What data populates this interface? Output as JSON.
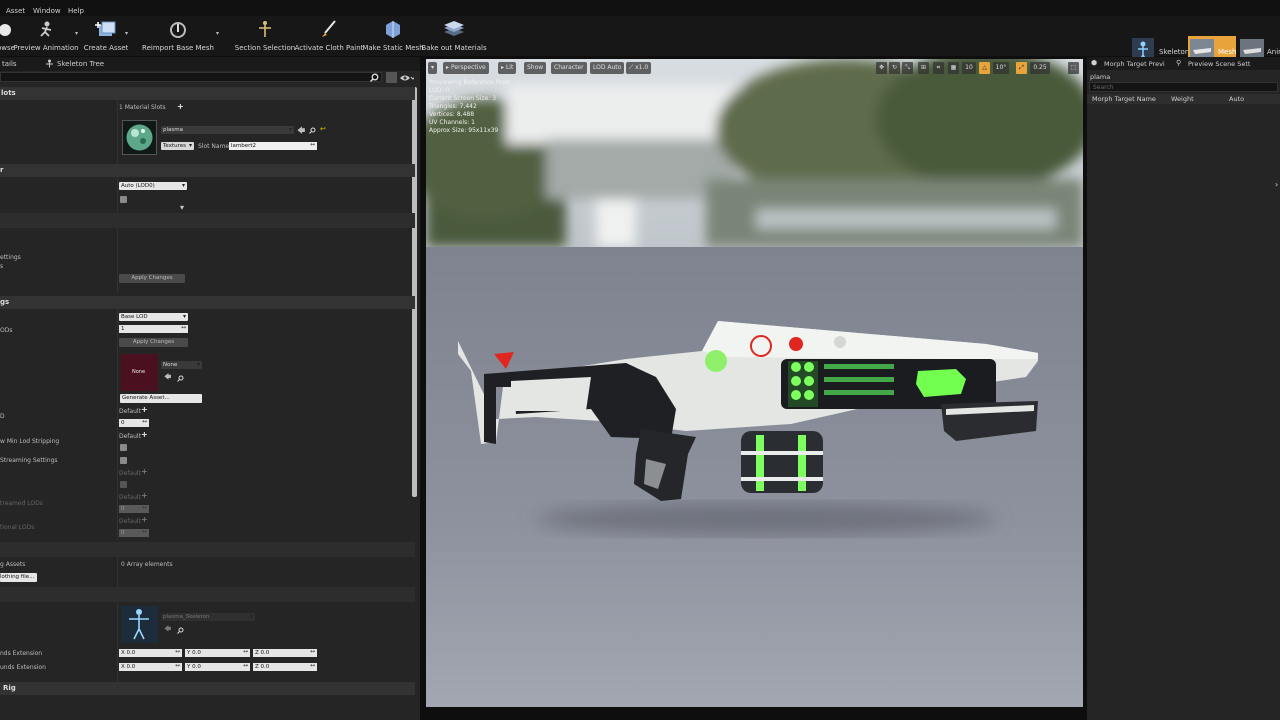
{
  "menu": {
    "asset": "Asset",
    "window": "Window",
    "help": "Help"
  },
  "toolbar": {
    "browse": "owse",
    "preview_animation": "Preview Animation",
    "create_asset": "Create Asset",
    "reimport": "Reimport Base Mesh",
    "section_selection": "Section Selection",
    "activate_cloth": "Activate Cloth Paint",
    "make_static": "Make Static Mesh",
    "bake_materials": "Bake out Materials"
  },
  "mode_tabs": {
    "skeleton": "Skeleton",
    "mesh": "Mesh",
    "animation": "Anim"
  },
  "left_panel": {
    "tab_details": "tails",
    "tab_skeleton_tree": "Skeleton Tree",
    "cat_material_slots": "lots",
    "material_slots_count": "1 Material Slots",
    "material_name": "plasma",
    "textures_label": "Textures",
    "slot_name_label": "Slot Name",
    "slot_name_value": "lambert2",
    "cat_lod": "r",
    "lod_auto": "Auto (LOD0)",
    "settings_label": "ettings",
    "settings_label2": "s",
    "apply_changes": "Apply Changes",
    "cat_lod_settings": "gs",
    "lods_label": "ODs",
    "base_lod": "Base LOD",
    "lod_count": "1",
    "apply_changes2": "Apply Changes",
    "none_thumb": "None",
    "none_dropdown": "None",
    "generate_asset": "Generate Asset...",
    "default1": "Default",
    "val1": "0",
    "d_label": "D",
    "min_lod_label": "w Min Lod Stripping",
    "default2": "Default",
    "streaming_label": "Streaming Settings",
    "default3": "Default",
    "streamed_lods_label": "treamed LODs",
    "default4": "Default",
    "val2": "0",
    "optional_lods_label": "tional LODs",
    "default5": "Default",
    "val3": "0",
    "assets_label": "g Assets",
    "array_elements": "0 Array elements",
    "clothing_btn": "lothing file...",
    "skeleton_name": "plasma_Skeleton",
    "bounds_ext1": "nds Extension",
    "bounds_ext2": "unds Extension",
    "x1": "X 0.0",
    "y1": "Y 0.0",
    "z1": "Z 0.0",
    "x2": "X 0.0",
    "y2": "Y 0.0",
    "z2": "Z 0.0",
    "rig_label": "Rig"
  },
  "viewport": {
    "perspective": "Perspective",
    "lit": "Lit",
    "show": "Show",
    "character": "Character",
    "lod_auto": "LOD Auto",
    "speed": "x1.0",
    "grid_val": "10",
    "rot_val": "10°",
    "scale_val": "0.25",
    "info": [
      "Previewing Reference Pose",
      "LOD: 0",
      "Current Screen Size: 3",
      "Triangles: 7,442",
      "Vertices: 8,488",
      "UV Channels: 1",
      "Approx Size: 95x11x39"
    ]
  },
  "right_panel": {
    "tab_morph": "Morph Target Previ",
    "tab_scene": "Preview Scene Sett",
    "object_name": "plama",
    "search_placeholder": "Search",
    "col_name": "Morph Target Name",
    "col_weight": "Weight",
    "col_auto": "Auto"
  },
  "colors": {
    "accent_orange": "#e8a33a",
    "neon_green": "#66ff55",
    "gun_white": "#e8ebe8",
    "gun_dark": "#1d1f22",
    "red_accent": "#e0261e"
  }
}
